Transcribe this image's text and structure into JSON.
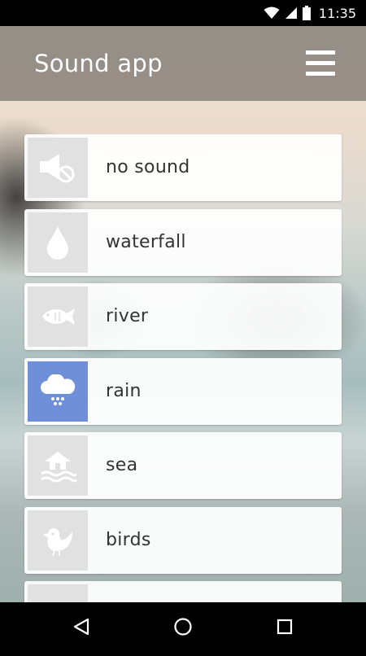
{
  "status_bar": {
    "time": "11:35",
    "icons": [
      "wifi-icon",
      "cell-signal-icon",
      "battery-icon"
    ]
  },
  "app_bar": {
    "title": "Sound app",
    "menu_icon": "hamburger-menu-icon"
  },
  "colors": {
    "app_bar": "#827d76",
    "icon_box": "#e1e1e1",
    "active_icon_box": "#6f8fd8",
    "item_background": "#ffffff",
    "label_text": "#333333"
  },
  "sounds": [
    {
      "label": "no sound",
      "icon": "muted-speaker-icon",
      "active": false
    },
    {
      "label": "waterfall",
      "icon": "water-drop-icon",
      "active": false
    },
    {
      "label": "river",
      "icon": "fish-icon",
      "active": false
    },
    {
      "label": "rain",
      "icon": "rain-cloud-icon",
      "active": true
    },
    {
      "label": "sea",
      "icon": "beach-hut-waves-icon",
      "active": false
    },
    {
      "label": "birds",
      "icon": "bird-icon",
      "active": false
    },
    {
      "label": "",
      "icon": "partially-visible-icon",
      "active": false
    }
  ],
  "nav_bar": {
    "back": "back-triangle-icon",
    "home": "home-circle-icon",
    "recents": "recents-square-icon"
  }
}
